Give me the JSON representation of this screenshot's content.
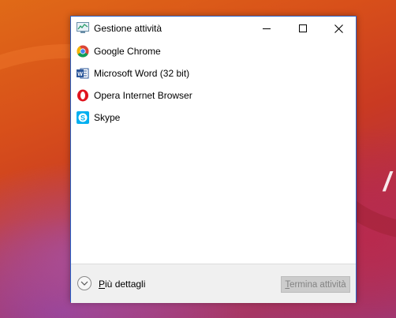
{
  "window": {
    "title": "Gestione attività",
    "icon": "task-manager-icon",
    "controls": [
      "minimize-icon",
      "maximize-icon",
      "close-icon"
    ]
  },
  "apps": [
    {
      "label": "Google Chrome",
      "icon": "chrome-icon"
    },
    {
      "label": "Microsoft Word (32 bit)",
      "icon": "word-icon"
    },
    {
      "label": "Opera Internet Browser",
      "icon": "opera-icon"
    },
    {
      "label": "Skype",
      "icon": "skype-icon"
    }
  ],
  "footer": {
    "details_label": "Più dettagli",
    "details_icon": "chevron-down-icon",
    "end_task_label": "Termina attività"
  },
  "colors": {
    "window_border": "#2b64c9",
    "footer_bg": "#f0f0f0",
    "disabled_button": "#cccccc",
    "chrome_red": "#db4437",
    "chrome_yellow": "#f4b400",
    "chrome_green": "#0f9d58",
    "chrome_blue": "#4285f4",
    "word_blue": "#2b579a",
    "opera_red": "#e0141e",
    "skype_blue": "#00aff0"
  }
}
